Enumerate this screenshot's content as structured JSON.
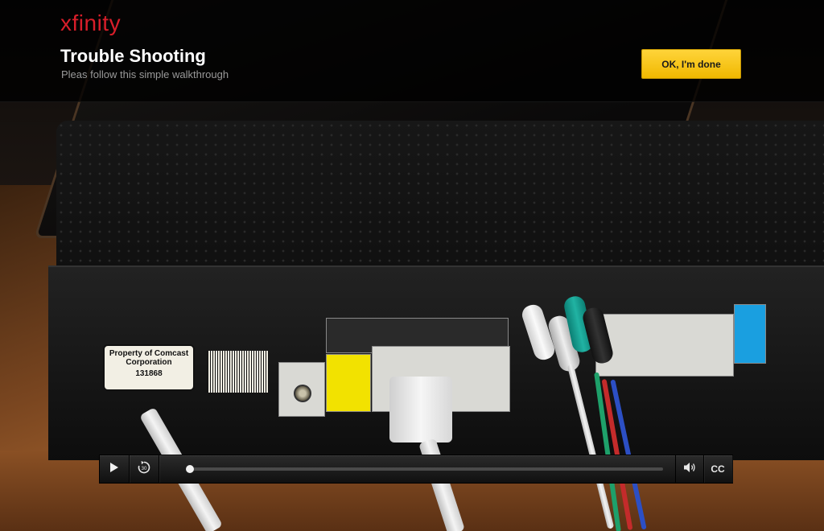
{
  "header": {
    "logo": "xfinity",
    "title": "Trouble Shooting",
    "subtitle": "Pleas follow this simple walkthrough",
    "done_button": "OK, I'm done"
  },
  "scene": {
    "sticker_property": "Property of Comcast Corporation",
    "sticker_number": "131868"
  },
  "player": {
    "progress_fraction": 0.0,
    "cc_label": "CC",
    "icons": [
      "play-icon",
      "rewind-30-icon",
      "volume-icon",
      "closed-captions-icon"
    ]
  },
  "colors": {
    "brand_red": "#d81e2a",
    "button_yellow": "#f5c400"
  }
}
